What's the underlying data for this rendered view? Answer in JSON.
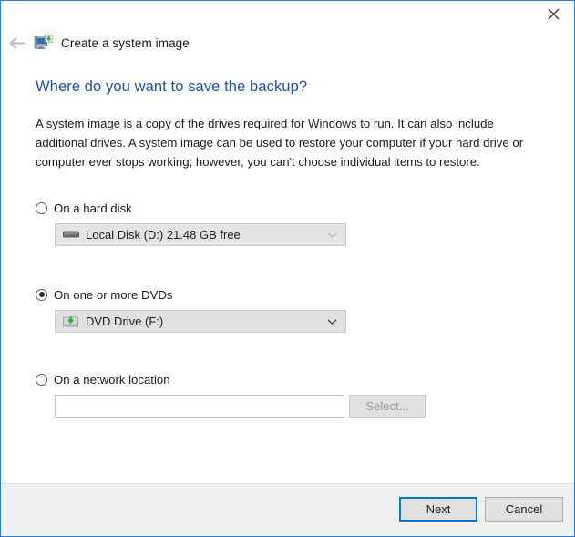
{
  "window": {
    "border_color": "#2a7fd4",
    "close_icon": "close-icon"
  },
  "nav": {
    "back_icon": "back-arrow-icon",
    "wizard_icon": "system-image-icon",
    "title": "Create a system image"
  },
  "page": {
    "heading": "Where do you want to save the backup?",
    "heading_color": "#1f4f9c",
    "body": "A system image is a copy of the drives required for Windows to run. It can also include additional drives. A system image can be used to restore your computer if your hard drive or computer ever stops working; however, you can't choose individual items to restore."
  },
  "options": [
    {
      "id": "hard-disk",
      "label": "On a hard disk",
      "selected": false,
      "combo": {
        "icon": "hard-drive-icon",
        "value": "Local Disk (D:)  21.48 GB free",
        "enabled": false
      }
    },
    {
      "id": "dvds",
      "label": "On one or more DVDs",
      "selected": true,
      "combo": {
        "icon": "dvd-drive-icon",
        "value": "DVD Drive (F:)",
        "enabled": true
      }
    },
    {
      "id": "network-location",
      "label": "On a network location",
      "selected": false,
      "input": {
        "value": "",
        "placeholder": ""
      },
      "button": {
        "label": "Select...",
        "enabled": false
      }
    }
  ],
  "footer": {
    "next_label": "Next",
    "cancel_label": "Cancel",
    "accent_color": "#0078d7"
  }
}
